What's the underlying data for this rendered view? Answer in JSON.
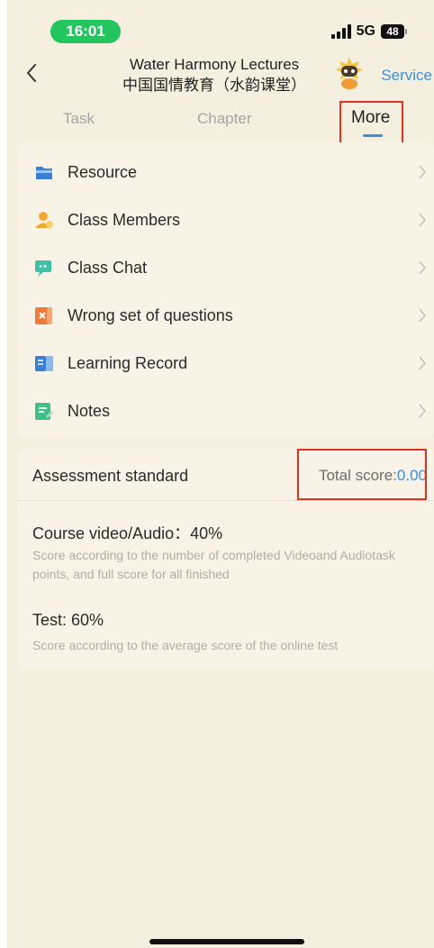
{
  "status_bar": {
    "time": "16:01",
    "network": "5G",
    "battery": "48"
  },
  "header": {
    "back_icon": "chevron-left-icon",
    "title_line1": "Water Harmony Lectures",
    "title_line2": "中国国情教育（水韵课堂）",
    "service_label": "Service"
  },
  "tabs": [
    {
      "label": "Task",
      "active": false
    },
    {
      "label": "Chapter",
      "active": false
    },
    {
      "label": "More",
      "active": true
    }
  ],
  "menu": [
    {
      "label": "Resource",
      "icon": "folder-icon",
      "color": "#3b7fd4"
    },
    {
      "label": "Class Members",
      "icon": "person-icon",
      "color": "#f0a830"
    },
    {
      "label": "Class Chat",
      "icon": "chat-icon",
      "color": "#3fc1a6"
    },
    {
      "label": "Wrong set of questions",
      "icon": "wrong-questions-icon",
      "color": "#ef7a3a"
    },
    {
      "label": "Learning Record",
      "icon": "book-icon",
      "color": "#3b7fd4"
    },
    {
      "label": "Notes",
      "icon": "notes-icon",
      "color": "#3fbf8a"
    }
  ],
  "assessment": {
    "title": "Assessment standard",
    "total_label": "Total score:",
    "total_value": "0.00",
    "criteria": [
      {
        "title": "Course video/Audio：40%",
        "desc": "Score according to the number of completed Videoand Audiotask points, and full score for all finished"
      },
      {
        "title": "Test: 60%",
        "desc": "Score according to the average score of the online test"
      }
    ]
  },
  "colors": {
    "accent": "#3f8fd6",
    "highlight_box": "#e0331e",
    "background": "#f5efdf",
    "time_pill": "#22c55e"
  }
}
